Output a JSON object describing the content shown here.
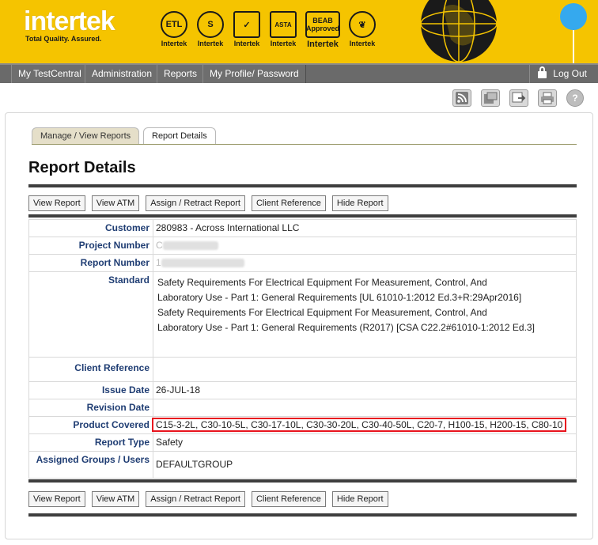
{
  "brand": {
    "name": "intertek",
    "tagline": "Total Quality. Assured.",
    "certifications": [
      {
        "mark": "ETL",
        "label": "Intertek"
      },
      {
        "mark": "S",
        "label": "Intertek"
      },
      {
        "mark": "✓",
        "label": "Intertek"
      },
      {
        "mark": "ASTA",
        "label": "Intertek"
      },
      {
        "mark": "BEAB Approved",
        "label": "Intertek"
      },
      {
        "mark": "❦",
        "label": "Intertek"
      }
    ]
  },
  "nav": {
    "items": [
      "My TestCentral",
      "Administration",
      "Reports",
      "My Profile/ Password"
    ],
    "logout": "Log Out"
  },
  "tools": [
    "rss-icon",
    "export-icon",
    "forward-icon",
    "print-icon",
    "help-icon"
  ],
  "tabs": {
    "manage": "Manage / View Reports",
    "details": "Report Details"
  },
  "page_title": "Report Details",
  "buttons": {
    "view_report": "View Report",
    "view_atm": "View ATM",
    "assign_retract": "Assign / Retract Report",
    "client_reference": "Client Reference",
    "hide_report": "Hide Report"
  },
  "details": {
    "customer_label": "Customer",
    "customer_value": "280983 - Across International LLC",
    "project_label": "Project Number",
    "project_value": "C",
    "report_number_label": "Report Number",
    "report_number_value": "1",
    "standard_label": "Standard",
    "standard_line1": "Safety Requirements For Electrical Equipment For Measurement, Control, And",
    "standard_line2": "Laboratory Use - Part 1: General Requirements [UL 61010-1:2012 Ed.3+R:29Apr2016]",
    "standard_line3": "Safety Requirements For Electrical Equipment For Measurement, Control, And",
    "standard_line4": "Laboratory Use - Part 1: General Requirements (R2017) [CSA C22.2#61010-1:2012 Ed.3]",
    "client_ref_label": "Client Reference",
    "client_ref_value": "",
    "issue_date_label": "Issue Date",
    "issue_date_value": "26-JUL-18",
    "revision_date_label": "Revision Date",
    "revision_date_value": "",
    "product_covered_label": "Product Covered",
    "product_covered_value": "C15-3-2L, C30-10-5L, C30-17-10L, C30-30-20L, C30-40-50L, C20-7, H100-15, H200-15, C80-10",
    "report_type_label": "Report Type",
    "report_type_value": "Safety",
    "assigned_label": "Assigned Groups / Users",
    "assigned_value": "DEFAULTGROUP"
  },
  "colors": {
    "header_bg": "#f5c400",
    "nav_bg": "#6a6a6a",
    "label_blue": "#1f3d73",
    "highlight_red": "#e8141e"
  }
}
